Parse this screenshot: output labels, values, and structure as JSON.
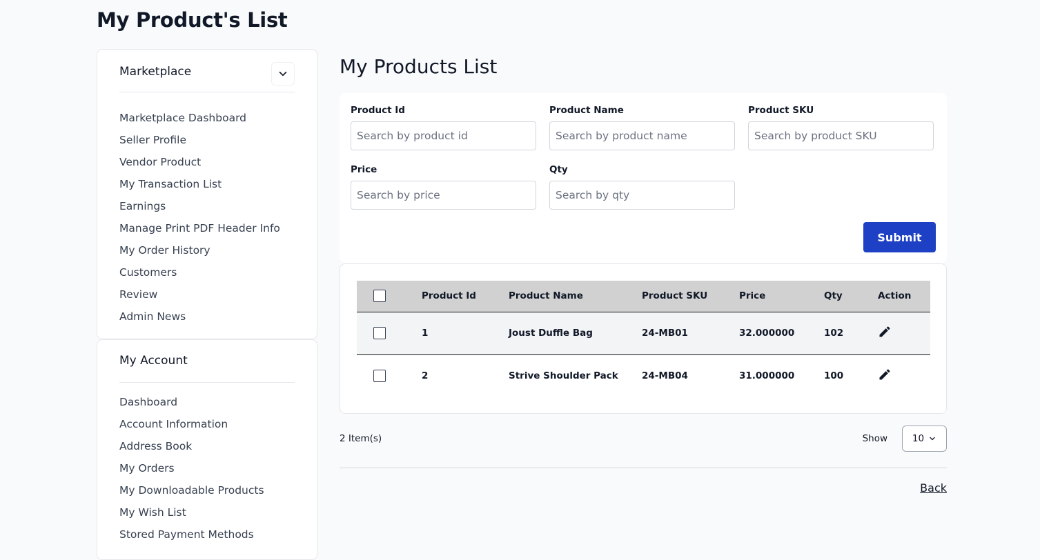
{
  "page": {
    "title": "My Product's List"
  },
  "sidebar": {
    "marketplace": {
      "title": "Marketplace",
      "items": [
        "Marketplace Dashboard",
        "Seller Profile",
        "Vendor Product",
        "My Transaction List",
        "Earnings",
        "Manage Print PDF Header Info",
        "My Order History",
        "Customers",
        "Review",
        "Admin News"
      ]
    },
    "account": {
      "title": "My Account",
      "items": [
        "Dashboard",
        "Account Information",
        "Address Book",
        "My Orders",
        "My Downloadable Products",
        "My Wish List",
        "Stored Payment Methods"
      ]
    }
  },
  "main": {
    "title": "My Products List",
    "filters": {
      "product_id": {
        "label": "Product Id",
        "placeholder": "Search by product id",
        "value": ""
      },
      "product_name": {
        "label": "Product Name",
        "placeholder": "Search by product name",
        "value": ""
      },
      "product_sku": {
        "label": "Product SKU",
        "placeholder": "Search by product SKU",
        "value": ""
      },
      "price": {
        "label": "Price",
        "placeholder": "Search by price",
        "value": ""
      },
      "qty": {
        "label": "Qty",
        "placeholder": "Search by qty",
        "value": ""
      },
      "submit_label": "Submit"
    },
    "table": {
      "headers": [
        "Product Id",
        "Product Name",
        "Product SKU",
        "Price",
        "Qty",
        "Action"
      ],
      "rows": [
        {
          "id": "1",
          "name": "Joust Duffle Bag",
          "sku": "24-MB01",
          "price": "32.000000",
          "qty": "102"
        },
        {
          "id": "2",
          "name": "Strive Shoulder Pack",
          "sku": "24-MB04",
          "price": "31.000000",
          "qty": "100"
        }
      ]
    },
    "footer": {
      "item_count": "2 Item(s)",
      "show_label": "Show",
      "page_size": "10",
      "back_label": "Back"
    }
  },
  "colors": {
    "primary": "#1d40c4",
    "table_header": "#d1d1d1",
    "page_bg": "#f9fafb"
  },
  "icons": {
    "collapse": "chevron-down-icon",
    "edit": "pencil-icon",
    "select_chevron": "chevron-down-icon"
  }
}
